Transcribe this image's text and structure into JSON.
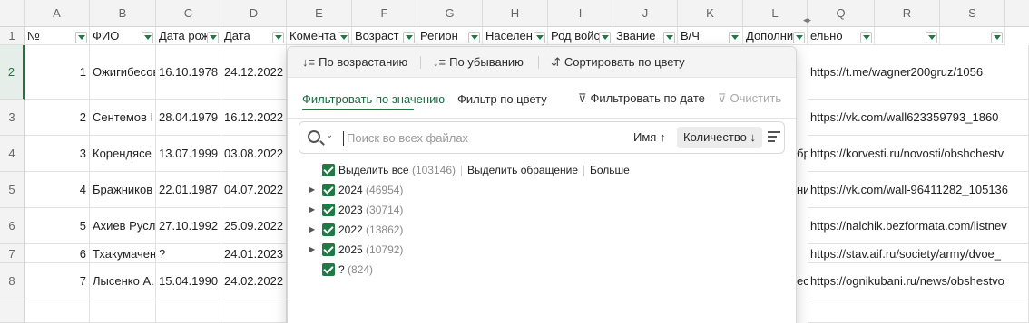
{
  "columns": [
    "A",
    "B",
    "C",
    "D",
    "E",
    "F",
    "G",
    "H",
    "I",
    "J",
    "K",
    "L",
    "Q",
    "R",
    "S"
  ],
  "rows": [
    "1",
    "2",
    "3",
    "4",
    "5",
    "6",
    "7",
    "8"
  ],
  "header_cells": [
    "№",
    "ФИО",
    "Дата рож",
    "Дата",
    "Комента",
    "Возраст",
    "Регион",
    "Населен",
    "Род войс",
    "Звание",
    "В/Ч",
    "Дополни",
    "ельно"
  ],
  "data_rows": [
    {
      "num": "1",
      "fio": "Ожигибесов",
      "birth": "16.10.1978",
      "date": "24.12.2022",
      "link": "https://t.me/wagner200gruz/1056"
    },
    {
      "num": "2",
      "fio": "Сентемов I",
      "birth": "28.04.1979",
      "date": "16.12.2022",
      "link": "https://vk.com/wall623359793_1860"
    },
    {
      "num": "3",
      "fio": "Корендясе",
      "birth": "13.07.1999",
      "date": "03.08.2022",
      "link": "https://korvesti.ru/novosti/obshchestv",
      "side": "бр"
    },
    {
      "num": "4",
      "fio": "Бражников",
      "birth": "22.01.1987",
      "date": "04.07.2022",
      "link": "https://vk.com/wall-96411282_105136",
      "side": "ни"
    },
    {
      "num": "5",
      "fio": "Ахиев Русл",
      "birth": "27.10.1992",
      "date": "25.09.2022",
      "link": "https://nalchik.bezformata.com/listnev"
    },
    {
      "num": "6",
      "fio": "Тхакумачен",
      "birth": "?",
      "date": "24.01.2023",
      "link": "https://stav.aif.ru/society/army/dvoe_"
    },
    {
      "num": "7",
      "fio": "Лысенко А.",
      "birth": "15.04.1990",
      "date": "24.02.2022",
      "link": "https://ognikubani.ru/news/obshestvo",
      "side": "ес"
    }
  ],
  "popup": {
    "sort_asc": "По возрастанию",
    "sort_desc": "По убыванию",
    "sort_color": "Сортировать по цвету",
    "tab_value": "Фильтровать по значению",
    "tab_color": "Фильтр по цвету",
    "date_filter": "Фильтровать по дате",
    "clear": "Очистить",
    "search_placeholder": "Поиск во всех файлах",
    "sort_name": "Имя",
    "sort_count": "Количество",
    "select_all": "Выделить все",
    "select_all_count": "(103146)",
    "invert": "Выделить обращение",
    "more": "Больше",
    "items": [
      {
        "label": "2024",
        "count": "(46954)"
      },
      {
        "label": "2023",
        "count": "(30714)"
      },
      {
        "label": "2022",
        "count": "(13862)"
      },
      {
        "label": "2025",
        "count": "(10792)"
      },
      {
        "label": "?",
        "count": "(824)"
      }
    ]
  },
  "colors": {
    "accent": "#1f7a45"
  }
}
